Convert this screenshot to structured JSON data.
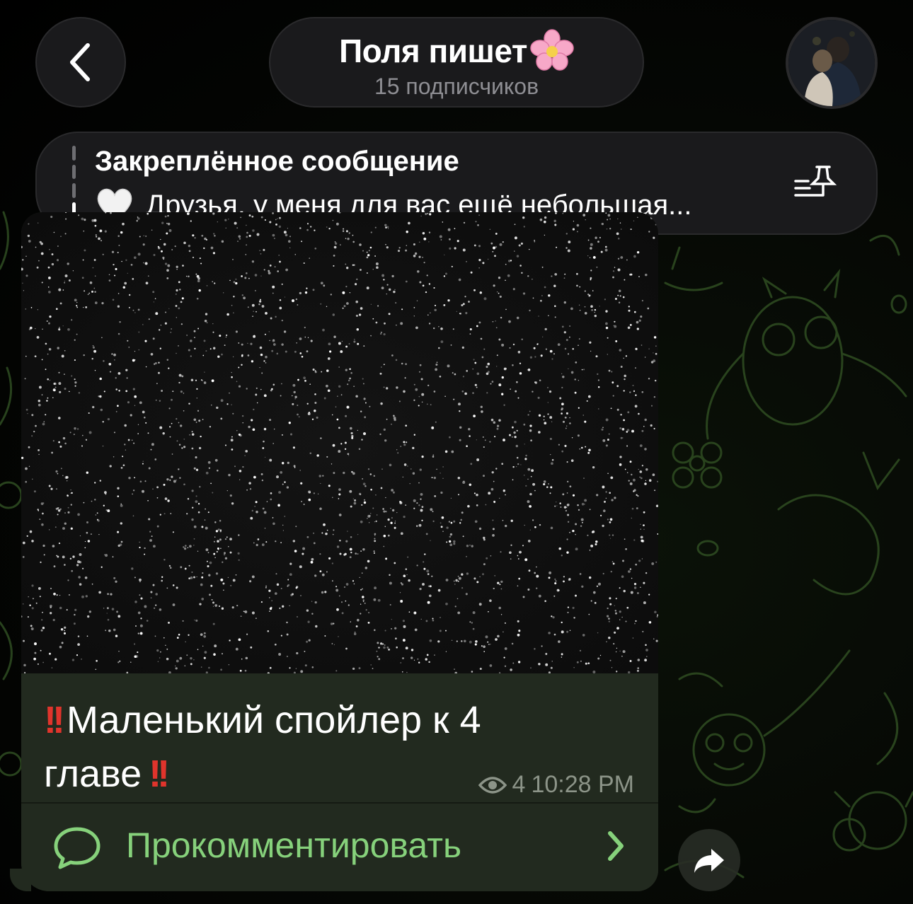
{
  "header": {
    "back_icon": "chevron-left-icon",
    "channel_name": "Поля пишет",
    "channel_emoji": "cherry-blossom-icon",
    "subscribers": "15 подписчиков"
  },
  "pinned": {
    "title": "Закреплённое сообщение",
    "emoji": "white-heart-icon",
    "preview": "Друзья, у меня для вас ещё небольшая...",
    "list_icon": "pinned-list-icon"
  },
  "message": {
    "caption_line1": "Маленький спойлер к 4",
    "caption_line2": "главе",
    "views": "4",
    "time": "10:28 PM",
    "comment_label": "Прокомментировать"
  },
  "colors": {
    "accent_green": "#86d17b",
    "bubble_bg": "#222a1f",
    "exclamation_red": "#e0342c"
  }
}
